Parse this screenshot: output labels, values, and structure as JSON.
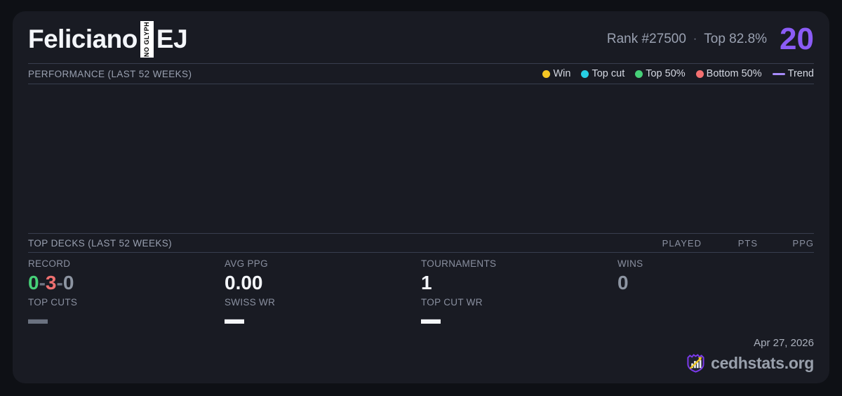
{
  "header": {
    "player_name": "Feliciano",
    "notdef_glyph_text": "NO GLYPH",
    "player_suffix": "EJ",
    "rank_text": "Rank #27500",
    "rank_separator": "·",
    "top_percent_text": "Top 82.8%",
    "score": "20"
  },
  "performance": {
    "title": "PERFORMANCE (LAST 52 WEEKS)",
    "legend": [
      {
        "label": "Win",
        "color": "#f5c724"
      },
      {
        "label": "Top cut",
        "color": "#27cfe4"
      },
      {
        "label": "Top 50%",
        "color": "#46d078"
      },
      {
        "label": "Bottom 50%",
        "color": "#f37070"
      },
      {
        "label": "Trend",
        "color": "#a78bfa"
      }
    ]
  },
  "top_decks": {
    "title": "TOP DECKS (LAST 52 WEEKS)",
    "columns": {
      "played": "PLAYED",
      "pts": "PTS",
      "ppg": "PPG"
    },
    "rows": []
  },
  "stats": {
    "record": {
      "label": "RECORD",
      "wins": "0",
      "losses": "3",
      "draws": "0",
      "separator": "-"
    },
    "avg_ppg": {
      "label": "AVG PPG",
      "value": "0.00"
    },
    "tournaments": {
      "label": "TOURNAMENTS",
      "value": "1"
    },
    "wins": {
      "label": "WINS",
      "value": "0"
    },
    "top_cuts": {
      "label": "TOP CUTS",
      "value": "—"
    },
    "swiss_wr": {
      "label": "SWISS WR",
      "value": "—"
    },
    "top_cut_wr": {
      "label": "TOP CUT WR",
      "value": "—"
    }
  },
  "footer": {
    "date": "Apr 27, 2026",
    "site_name": "cedhstats.org"
  },
  "colors": {
    "accent_purple": "#8b5cf6",
    "win_yellow": "#f5c724",
    "top_cut_cyan": "#27cfe4",
    "top50_green": "#46d078",
    "bottom50_red": "#f37070",
    "trend_purple": "#a78bfa",
    "card_bg": "#191b23",
    "page_bg": "#0e1015"
  }
}
